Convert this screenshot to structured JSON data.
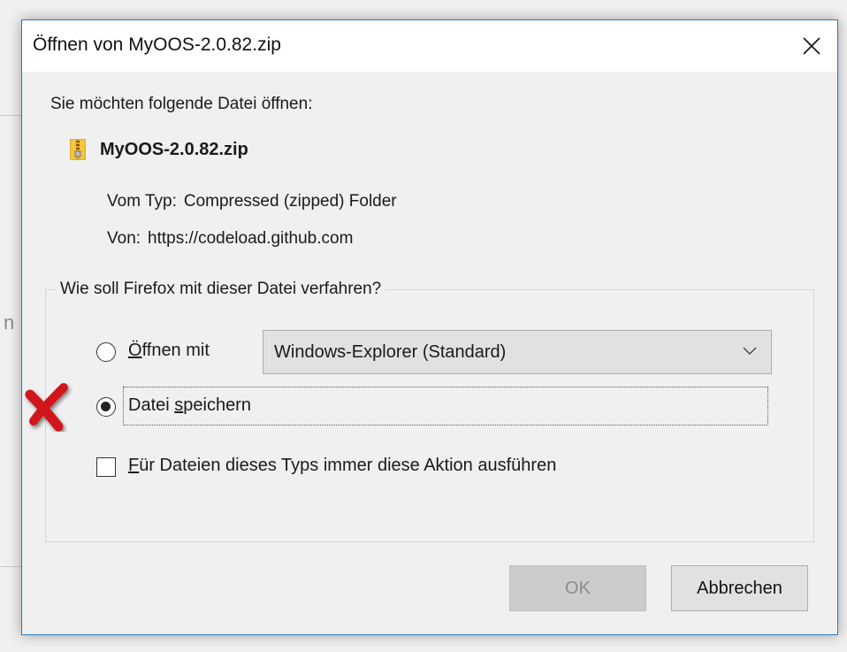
{
  "dialog": {
    "title": "Öffnen von MyOOS-2.0.82.zip",
    "close_icon": "close-icon",
    "prompt": "Sie möchten folgende Datei öffnen:",
    "file": {
      "icon": "zip-folder-icon",
      "name": "MyOOS-2.0.82.zip",
      "type_label": "Vom Typ:",
      "type_value": "Compressed (zipped) Folder",
      "from_label": "Von:",
      "from_value": "https://codeload.github.com"
    },
    "action_group": {
      "legend": "Wie soll Firefox mit dieser Datei verfahren?",
      "open_with": {
        "label_underlined": "Ö",
        "label_rest": "ffnen mit",
        "checked": false,
        "app_select": {
          "selected": "Windows-Explorer (Standard)",
          "chevron_icon": "chevron-down-icon"
        }
      },
      "save_file": {
        "label_before": "Datei ",
        "label_underlined": "s",
        "label_rest": "peichern",
        "checked": true
      },
      "always_do": {
        "label_underlined": "F",
        "label_rest": "ür Dateien dieses Typs immer diese Aktion ausführen",
        "checked": false
      }
    },
    "buttons": {
      "ok": "OK",
      "cancel": "Abbrechen"
    }
  },
  "annotation": {
    "marker_icon": "red-x-mark-icon",
    "color": "#d0141b"
  },
  "background": {
    "fragment_text": "n"
  }
}
